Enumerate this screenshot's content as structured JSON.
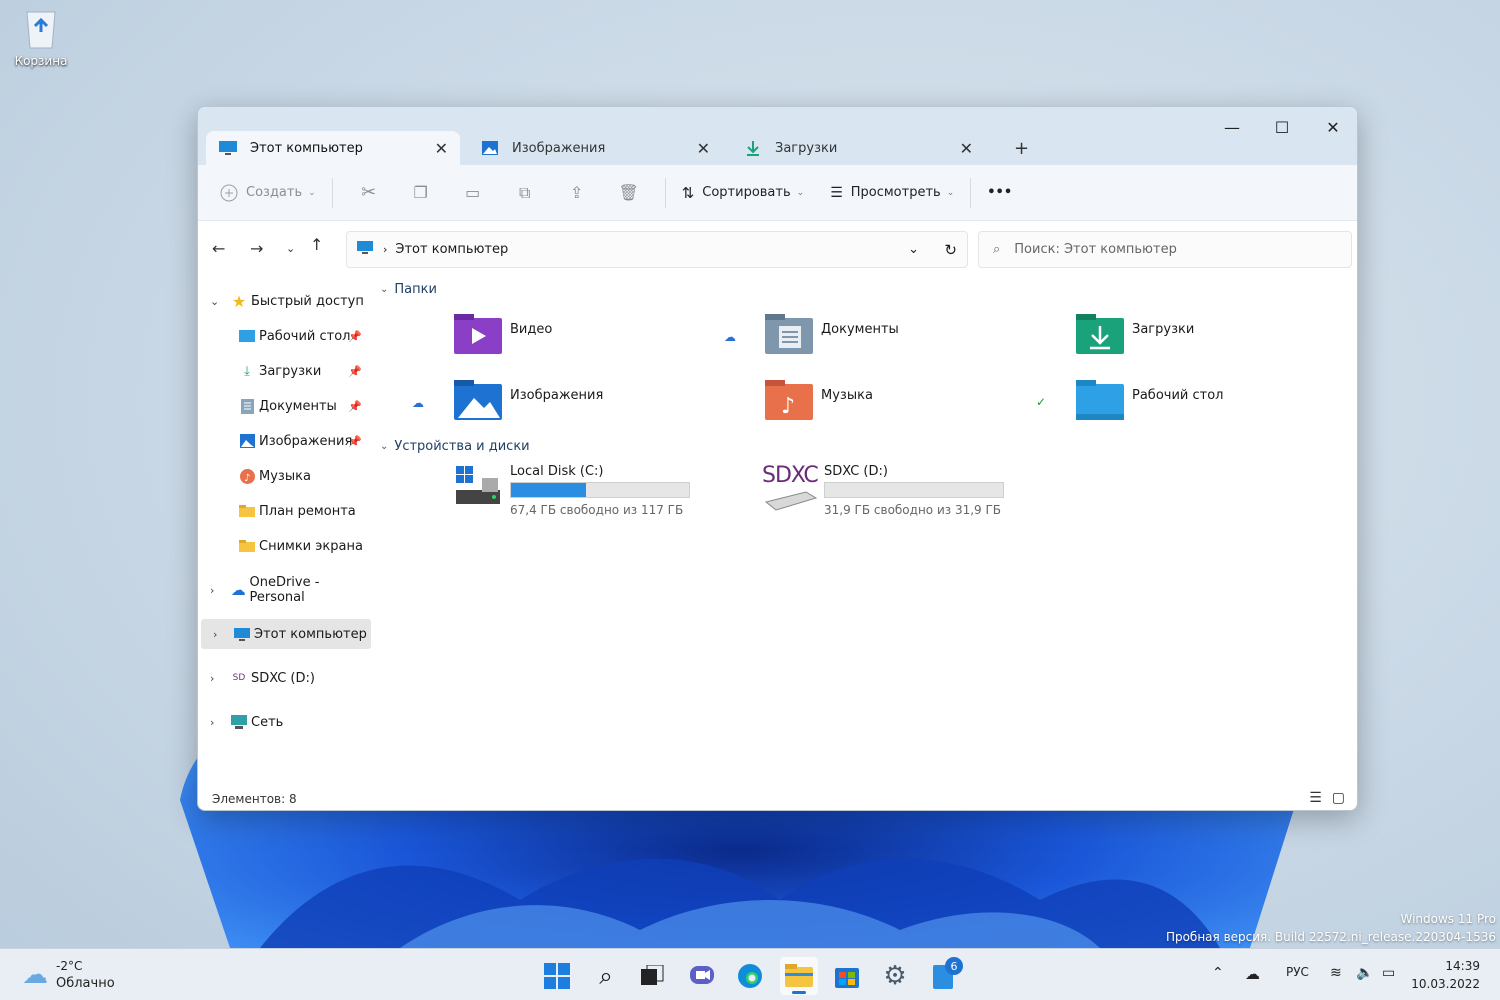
{
  "desktop": {
    "recycle_bin_label": "Корзина"
  },
  "window": {
    "tabs": [
      {
        "label": "Этот компьютер"
      },
      {
        "label": "Изображения"
      },
      {
        "label": "Загрузки"
      }
    ],
    "toolbar": {
      "create_label": "Создать",
      "sort_label": "Сортировать",
      "view_label": "Просмотреть",
      "more_label": "•••"
    },
    "address": {
      "path": "Этот компьютер"
    },
    "search": {
      "placeholder": "Поиск: Этот компьютер"
    },
    "sidebar": {
      "quick_access": "Быстрый доступ",
      "items": [
        {
          "label": "Рабочий стол"
        },
        {
          "label": "Загрузки"
        },
        {
          "label": "Документы"
        },
        {
          "label": "Изображения"
        },
        {
          "label": "Музыка"
        },
        {
          "label": "План ремонта"
        },
        {
          "label": "Снимки экрана"
        }
      ],
      "onedrive": "OneDrive - Personal",
      "this_pc": "Этот компьютер",
      "sdxc": "SDXC (D:)",
      "network": "Сеть"
    },
    "main": {
      "folders_header": "Папки",
      "folders": [
        {
          "label": "Видео"
        },
        {
          "label": "Документы"
        },
        {
          "label": "Загрузки"
        },
        {
          "label": "Изображения"
        },
        {
          "label": "Музыка"
        },
        {
          "label": "Рабочий стол"
        }
      ],
      "devices_header": "Устройства и диски",
      "drives": [
        {
          "label": "Local Disk (C:)",
          "free_text": "67,4 ГБ свободно из 117 ГБ",
          "used_fraction": 0.42
        },
        {
          "label": "SDXC (D:)",
          "free_text": "31,9 ГБ свободно из 31,9 ГБ",
          "used_fraction": 0.0
        }
      ],
      "sdxc_logo": "SDXC"
    },
    "status": {
      "items_count": "Элементов: 8"
    }
  },
  "watermark": {
    "line1": "Windows 11 Pro",
    "line2": "Пробная версия. Build 22572.ni_release.220304-1536"
  },
  "taskbar": {
    "weather_temp": "-2°C",
    "weather_desc": "Облачно",
    "badge_count": "6",
    "language": "РУС",
    "time": "14:39",
    "date": "10.03.2022"
  }
}
